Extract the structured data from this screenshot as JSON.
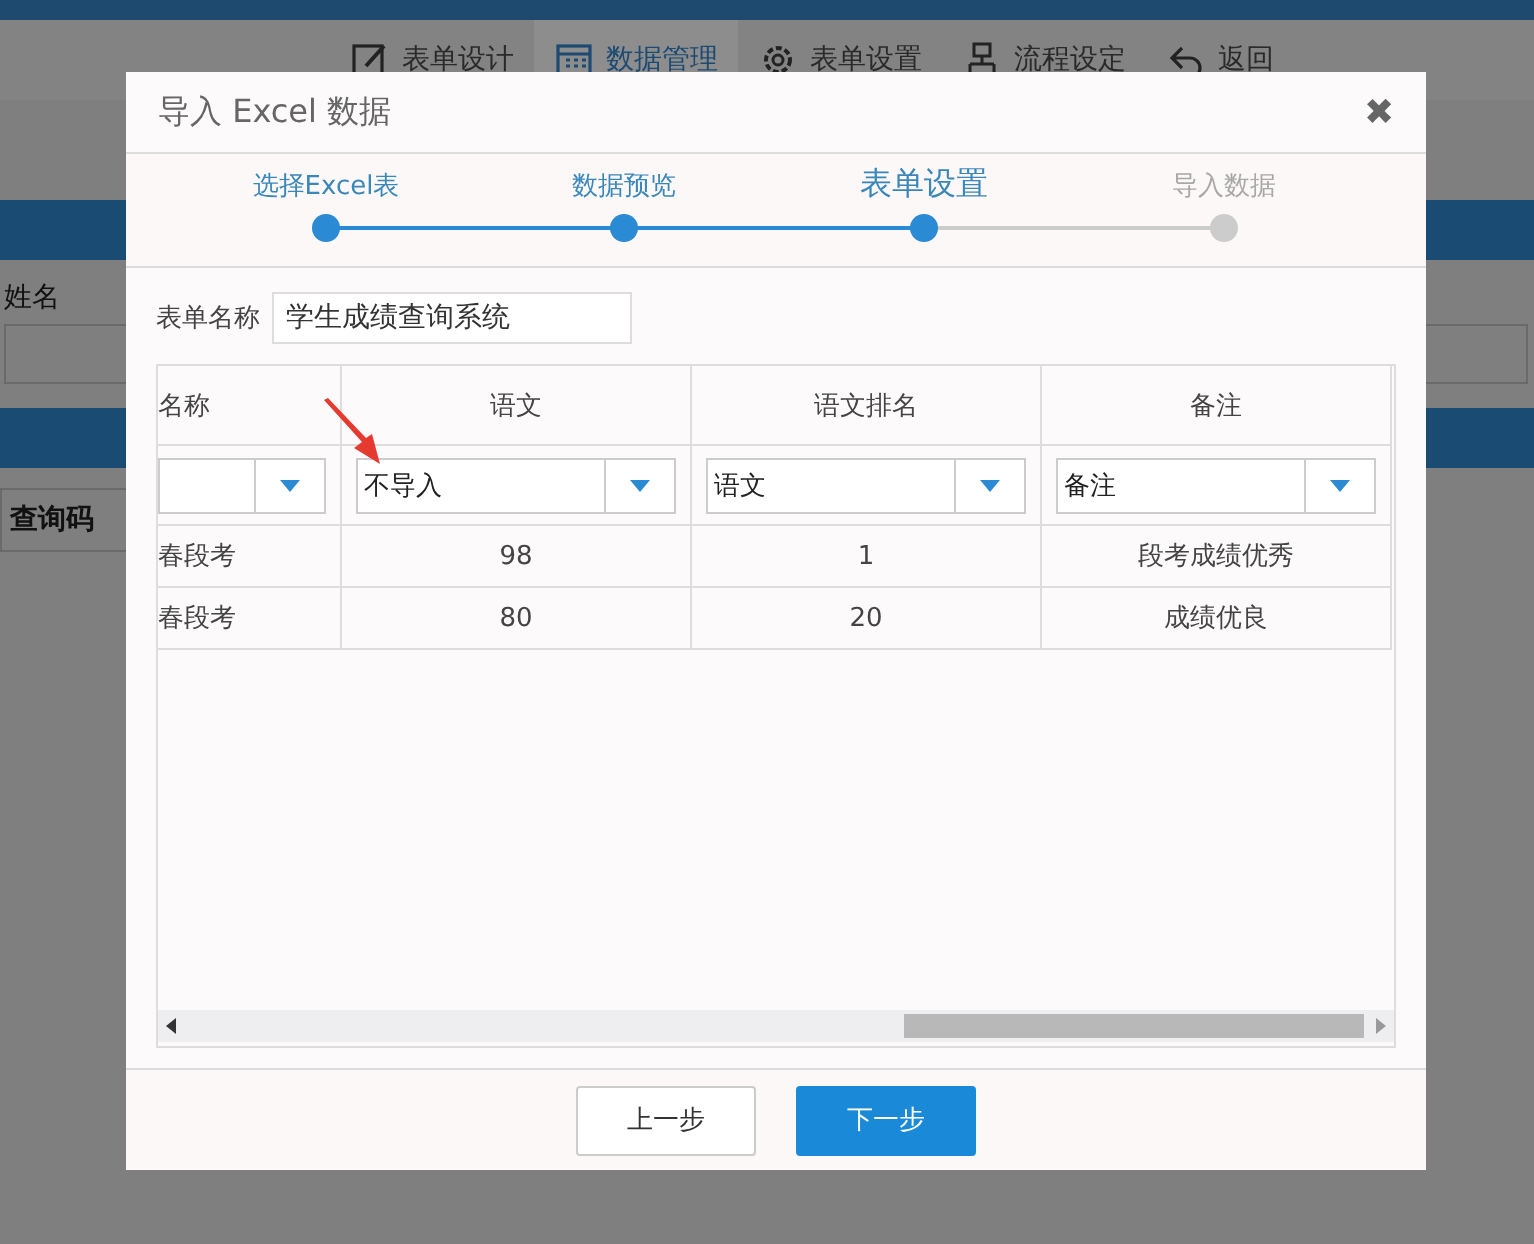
{
  "toolbar": {
    "items": [
      {
        "label": "表单设计",
        "selected": false
      },
      {
        "label": "数据管理",
        "selected": true
      },
      {
        "label": "表单设置",
        "selected": false
      },
      {
        "label": "流程设定",
        "selected": false
      },
      {
        "label": "返回",
        "selected": false
      }
    ]
  },
  "background": {
    "field_label": "姓名",
    "column_header": "查询码"
  },
  "dialog": {
    "title": "导入 Excel 数据",
    "close": "✖",
    "steps": [
      {
        "label": "选择Excel表",
        "reached": true,
        "selected": false
      },
      {
        "label": "数据预览",
        "reached": true,
        "selected": false
      },
      {
        "label": "表单设置",
        "reached": true,
        "selected": true
      },
      {
        "label": "导入数据",
        "reached": false,
        "selected": false
      }
    ],
    "form_name": {
      "label": "表单名称",
      "value": "学生成绩查询系统"
    },
    "table": {
      "columns": [
        {
          "header": "名称"
        },
        {
          "header": "语文",
          "mapping": "不导入"
        },
        {
          "header": "语文排名",
          "mapping": "语文"
        },
        {
          "header": "备注",
          "mapping": "备注"
        }
      ],
      "rows": [
        [
          "春段考",
          "98",
          "1",
          "段考成绩优秀"
        ],
        [
          "春段考",
          "80",
          "20",
          "成绩优良"
        ]
      ]
    },
    "buttons": [
      {
        "label": "上一步",
        "kind": "secondary"
      },
      {
        "label": "下一步",
        "kind": "primary"
      }
    ]
  }
}
